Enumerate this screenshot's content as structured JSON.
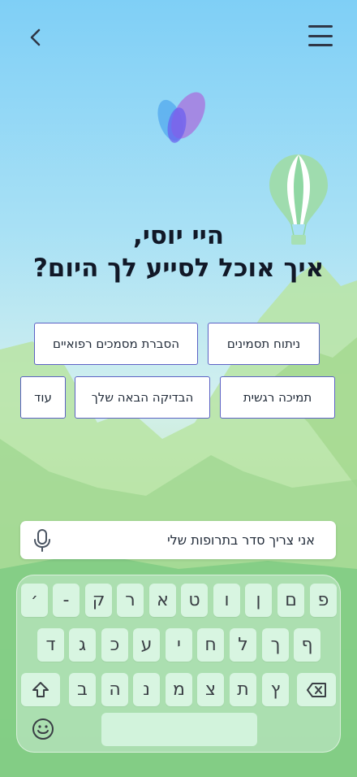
{
  "header": {
    "back_icon": "chevron-left-icon",
    "menu_icon": "hamburger-menu-icon"
  },
  "greeting": {
    "line1": "היי יוסי,",
    "line2": "איך אוכל לסייע לך היום?"
  },
  "suggestions": {
    "row1": [
      "ניתוח תסמינים",
      "הסברת מסמכים רפואיים"
    ],
    "row2": [
      "תמיכה רגשית",
      "הבדיקה הבאה שלך",
      "עוד"
    ]
  },
  "composer": {
    "value": "אני צריך סדר בתרופות שלי",
    "mic_icon": "microphone-icon"
  },
  "keyboard": {
    "row1": [
      "פ",
      "ם",
      "ן",
      "ו",
      "ט",
      "א",
      "ר",
      "ק",
      "-",
      "׳"
    ],
    "row2": [
      "ף",
      "ך",
      "ל",
      "ח",
      "י",
      "ע",
      "כ",
      "ג",
      "ד"
    ],
    "row3": [
      "ץ",
      "ת",
      "צ",
      "מ",
      "נ",
      "ה",
      "ב"
    ],
    "shift_icon": "shift-arrow-icon",
    "backspace_icon": "backspace-icon",
    "emoji_icon": "emoji-smile-icon"
  },
  "colors": {
    "accent": "#5c62c4",
    "key_bg": "#d8f5e1",
    "text": "#111827"
  }
}
